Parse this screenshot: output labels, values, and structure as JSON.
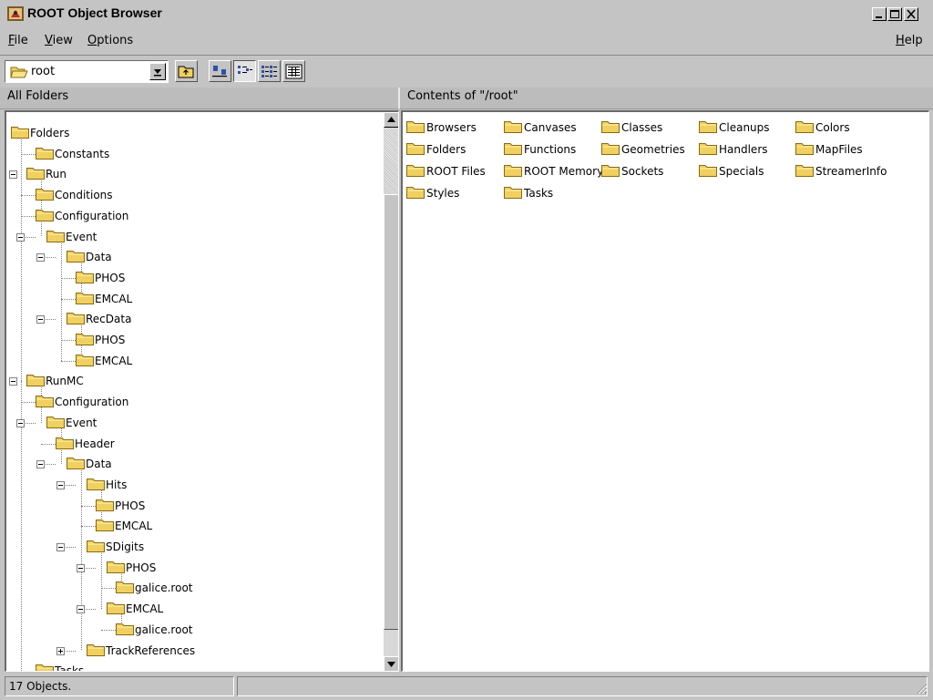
{
  "window": {
    "title": "ROOT Object Browser"
  },
  "menubar": {
    "file": {
      "key": "F",
      "rest": "ile"
    },
    "view": {
      "key": "V",
      "rest": "iew"
    },
    "options": {
      "key": "O",
      "rest": "ptions"
    },
    "help": {
      "key": "H",
      "rest": "elp"
    }
  },
  "toolbar": {
    "location": "root"
  },
  "panels": {
    "left_header": "All Folders",
    "right_header": "Contents of \"/root\""
  },
  "tree": [
    {
      "label": "Folders"
    },
    {
      "label": "Constants"
    },
    {
      "label": "Run"
    },
    {
      "label": "Conditions"
    },
    {
      "label": "Configuration"
    },
    {
      "label": "Event"
    },
    {
      "label": "Data"
    },
    {
      "label": "PHOS"
    },
    {
      "label": "EMCAL"
    },
    {
      "label": "RecData"
    },
    {
      "label": "PHOS"
    },
    {
      "label": "EMCAL"
    },
    {
      "label": "RunMC"
    },
    {
      "label": "Configuration"
    },
    {
      "label": "Event"
    },
    {
      "label": "Header"
    },
    {
      "label": "Data"
    },
    {
      "label": "Hits"
    },
    {
      "label": "PHOS"
    },
    {
      "label": "EMCAL"
    },
    {
      "label": "SDigits"
    },
    {
      "label": "PHOS"
    },
    {
      "label": "galice.root"
    },
    {
      "label": "EMCAL"
    },
    {
      "label": "galice.root"
    },
    {
      "label": "TrackReferences"
    },
    {
      "label": "Tasks"
    }
  ],
  "contents": [
    {
      "label": "Browsers"
    },
    {
      "label": "Canvases"
    },
    {
      "label": "Classes"
    },
    {
      "label": "Cleanups"
    },
    {
      "label": "Colors"
    },
    {
      "label": "Folders"
    },
    {
      "label": "Functions"
    },
    {
      "label": "Geometries"
    },
    {
      "label": "Handlers"
    },
    {
      "label": "MapFiles"
    },
    {
      "label": "ROOT Files"
    },
    {
      "label": "ROOT Memory"
    },
    {
      "label": "Sockets"
    },
    {
      "label": "Specials"
    },
    {
      "label": "StreamerInfo"
    },
    {
      "label": "Styles"
    },
    {
      "label": "Tasks"
    }
  ],
  "status": {
    "objects": "17 Objects."
  },
  "colors": {
    "background": "#c4c4c4",
    "folder": "#f0d060",
    "folder_edge": "#8a6a10"
  }
}
